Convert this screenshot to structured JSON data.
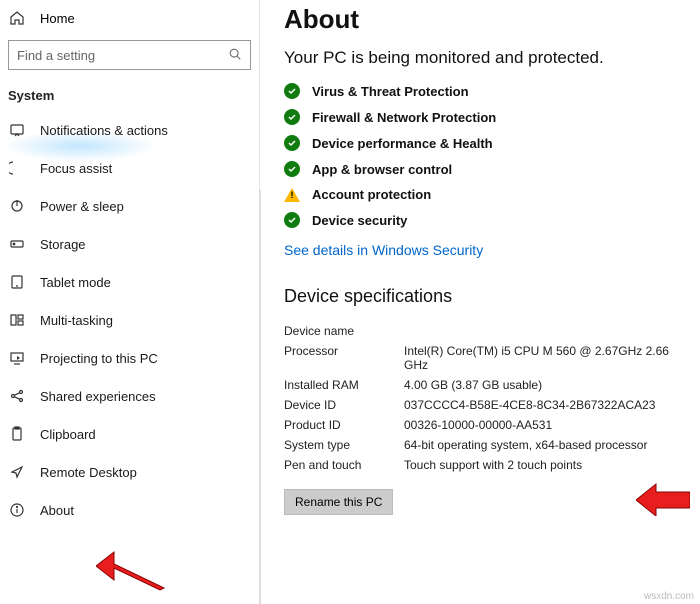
{
  "sidebar": {
    "home": "Home",
    "search_placeholder": "Find a setting",
    "section": "System",
    "items": [
      {
        "icon": "notifications",
        "label": "Notifications & actions"
      },
      {
        "icon": "focus",
        "label": "Focus assist"
      },
      {
        "icon": "power",
        "label": "Power & sleep"
      },
      {
        "icon": "storage",
        "label": "Storage"
      },
      {
        "icon": "tablet",
        "label": "Tablet mode"
      },
      {
        "icon": "multitask",
        "label": "Multi-tasking"
      },
      {
        "icon": "project",
        "label": "Projecting to this PC"
      },
      {
        "icon": "shared",
        "label": "Shared experiences"
      },
      {
        "icon": "clipboard",
        "label": "Clipboard"
      },
      {
        "icon": "remote",
        "label": "Remote Desktop"
      },
      {
        "icon": "about",
        "label": "About"
      }
    ]
  },
  "main": {
    "title": "About",
    "status_heading": "Your PC is being monitored and protected.",
    "status_items": [
      {
        "state": "ok",
        "label": "Virus & Threat Protection"
      },
      {
        "state": "ok",
        "label": "Firewall & Network Protection"
      },
      {
        "state": "ok",
        "label": "Device performance & Health"
      },
      {
        "state": "ok",
        "label": "App & browser control"
      },
      {
        "state": "warn",
        "label": "Account protection"
      },
      {
        "state": "ok",
        "label": "Device security"
      }
    ],
    "security_link": "See details in Windows Security",
    "spec_heading": "Device specifications",
    "specs": {
      "device_name_label": "Device name",
      "device_name_val": "",
      "processor_label": "Processor",
      "processor_val": "Intel(R) Core(TM) i5 CPU       M 560  @ 2.67GHz   2.66 GHz",
      "ram_label": "Installed RAM",
      "ram_val": "4.00 GB (3.87 GB usable)",
      "deviceid_label": "Device ID",
      "deviceid_val": "037CCCC4-B58E-4CE8-8C34-2B67322ACA23",
      "productid_label": "Product ID",
      "productid_val": "00326-10000-00000-AA531",
      "systype_label": "System type",
      "systype_val": "64-bit operating system, x64-based processor",
      "pen_label": "Pen and touch",
      "pen_val": "Touch support with 2 touch points"
    },
    "rename_btn": "Rename this PC"
  },
  "watermark": "wsxdn.com"
}
